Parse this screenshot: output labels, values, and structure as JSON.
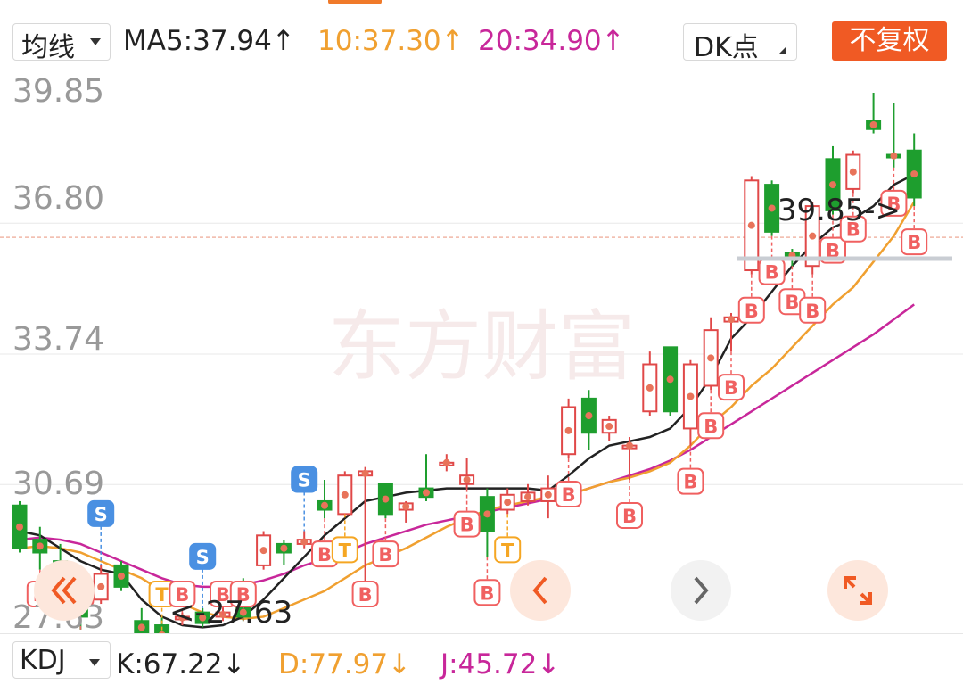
{
  "header": {
    "ma_selector": "均线",
    "ma5": "MA5:37.94↑",
    "ma10": "10:37.30↑",
    "ma20": "20:34.90↑",
    "dk_selector": "DK点",
    "adjust_button": "不复权"
  },
  "colors": {
    "up": "#e04848",
    "down": "#1e9e2e",
    "ma5": "#222222",
    "ma10": "#f0a030",
    "ma20": "#c8279a",
    "accent": "#f05a24",
    "marker_b": "#f06060",
    "marker_s": "#4a90e2",
    "marker_t": "#f5a623"
  },
  "chart": {
    "y_labels": [
      "39.85",
      "36.80",
      "33.74",
      "30.69",
      "27.63"
    ],
    "high_annotation": "39.85->",
    "low_annotation": "<-27.63",
    "watermark": "东方财富",
    "nav_icons": [
      "double-left-icon",
      "left-chevron-icon",
      "right-chevron-icon",
      "expand-icon"
    ]
  },
  "chart_data": {
    "type": "candlestick",
    "y_range": [
      27.63,
      39.85
    ],
    "ma_labels": [
      "MA5",
      "10",
      "20"
    ],
    "candles": [
      {
        "o": 30.2,
        "c": 29.2,
        "h": 30.3,
        "l": 29.1,
        "m": ""
      },
      {
        "o": 29.4,
        "c": 29.1,
        "h": 29.7,
        "l": 28.7,
        "m": "B"
      },
      {
        "o": 28.9,
        "c": 28.2,
        "h": 29.3,
        "l": 28.1,
        "m": ""
      },
      {
        "o": 27.9,
        "c": 27.6,
        "h": 28.4,
        "l": 27.3,
        "m": "B"
      },
      {
        "o": 28.0,
        "c": 28.6,
        "h": 28.8,
        "l": 27.9,
        "m": "S"
      },
      {
        "o": 28.8,
        "c": 28.3,
        "h": 28.9,
        "l": 28.2,
        "m": ""
      },
      {
        "o": 27.5,
        "c": 27.2,
        "h": 27.8,
        "l": 26.95,
        "m": ""
      },
      {
        "o": 27.4,
        "c": 26.95,
        "h": 27.6,
        "l": 26.7,
        "m": "T"
      },
      {
        "o": 27.55,
        "c": 27.6,
        "h": 27.7,
        "l": 27.4,
        "m": "B"
      },
      {
        "o": 27.7,
        "c": 27.45,
        "h": 27.8,
        "l": 27.35,
        "m": "S"
      },
      {
        "o": 27.6,
        "c": 27.7,
        "h": 28.3,
        "l": 27.5,
        "m": "B"
      },
      {
        "o": 27.8,
        "c": 27.6,
        "h": 28.5,
        "l": 27.5,
        "m": "B"
      },
      {
        "o": 28.8,
        "c": 29.5,
        "h": 29.6,
        "l": 28.7,
        "m": ""
      },
      {
        "o": 29.3,
        "c": 29.1,
        "h": 29.4,
        "l": 28.8,
        "m": ""
      },
      {
        "o": 29.3,
        "c": 29.4,
        "h": 29.6,
        "l": 29.2,
        "m": "S"
      },
      {
        "o": 30.3,
        "c": 30.1,
        "h": 30.8,
        "l": 29.9,
        "m": "B"
      },
      {
        "o": 30.0,
        "c": 30.9,
        "h": 31.0,
        "l": 30.0,
        "m": "T"
      },
      {
        "o": 30.9,
        "c": 31.0,
        "h": 31.1,
        "l": 28.0,
        "m": "B"
      },
      {
        "o": 30.7,
        "c": 30.0,
        "h": 30.7,
        "l": 29.9,
        "m": "B"
      },
      {
        "o": 30.1,
        "c": 30.25,
        "h": 30.3,
        "l": 29.8,
        "m": ""
      },
      {
        "o": 30.6,
        "c": 30.4,
        "h": 31.4,
        "l": 30.3,
        "m": ""
      },
      {
        "o": 31.2,
        "c": 31.2,
        "h": 31.4,
        "l": 31.0,
        "m": ""
      },
      {
        "o": 30.7,
        "c": 30.9,
        "h": 31.3,
        "l": 30.6,
        "m": "B"
      },
      {
        "o": 30.4,
        "c": 29.6,
        "h": 30.6,
        "l": 29.0,
        "m": "B"
      },
      {
        "o": 30.1,
        "c": 30.45,
        "h": 30.6,
        "l": 30.0,
        "m": "T"
      },
      {
        "o": 30.3,
        "c": 30.5,
        "h": 30.7,
        "l": 30.2,
        "m": ""
      },
      {
        "o": 30.3,
        "c": 30.6,
        "h": 30.9,
        "l": 29.9,
        "m": ""
      },
      {
        "o": 31.4,
        "c": 32.5,
        "h": 32.7,
        "l": 31.3,
        "m": "B"
      },
      {
        "o": 32.7,
        "c": 31.9,
        "h": 32.9,
        "l": 31.5,
        "m": ""
      },
      {
        "o": 31.9,
        "c": 32.2,
        "h": 32.3,
        "l": 31.7,
        "m": ""
      },
      {
        "o": 31.6,
        "c": 31.6,
        "h": 31.8,
        "l": 30.8,
        "m": "B"
      },
      {
        "o": 32.4,
        "c": 33.5,
        "h": 33.8,
        "l": 32.3,
        "m": ""
      },
      {
        "o": 33.9,
        "c": 32.4,
        "h": 33.9,
        "l": 32.3,
        "m": ""
      },
      {
        "o": 32.0,
        "c": 33.5,
        "h": 33.6,
        "l": 31.6,
        "m": "B"
      },
      {
        "o": 33.0,
        "c": 34.3,
        "h": 34.6,
        "l": 32.9,
        "m": "B"
      },
      {
        "o": 34.5,
        "c": 34.6,
        "h": 34.7,
        "l": 33.8,
        "m": "B"
      },
      {
        "o": 35.7,
        "c": 37.8,
        "h": 37.9,
        "l": 35.6,
        "m": "B"
      },
      {
        "o": 37.7,
        "c": 36.6,
        "h": 37.8,
        "l": 36.5,
        "m": "B"
      },
      {
        "o": 36.1,
        "c": 36.0,
        "h": 36.2,
        "l": 35.8,
        "m": "B"
      },
      {
        "o": 35.8,
        "c": 37.2,
        "h": 37.3,
        "l": 35.6,
        "m": "B"
      },
      {
        "o": 38.3,
        "c": 37.1,
        "h": 38.6,
        "l": 37.0,
        "m": "B"
      },
      {
        "o": 37.6,
        "c": 38.4,
        "h": 38.5,
        "l": 37.5,
        "m": "B"
      },
      {
        "o": 39.2,
        "c": 39.0,
        "h": 39.85,
        "l": 38.9,
        "m": ""
      },
      {
        "o": 38.4,
        "c": 38.35,
        "h": 39.6,
        "l": 38.1,
        "m": "B"
      },
      {
        "o": 38.5,
        "c": 37.4,
        "h": 38.9,
        "l": 37.2,
        "m": "B"
      }
    ],
    "ma5": [
      29.6,
      29.5,
      29.2,
      28.9,
      28.7,
      28.6,
      28.0,
      27.6,
      27.4,
      27.35,
      27.4,
      27.6,
      28.0,
      28.5,
      29.0,
      29.5,
      29.9,
      30.3,
      30.4,
      30.5,
      30.55,
      30.6,
      30.6,
      30.6,
      30.6,
      30.6,
      30.55,
      30.9,
      31.3,
      31.6,
      31.7,
      31.8,
      32.0,
      32.5,
      33.2,
      34.1,
      34.6,
      35.2,
      35.8,
      36.3,
      36.7,
      36.9,
      37.2,
      37.7,
      37.94
    ],
    "ma10": [
      29.2,
      29.25,
      29.2,
      29.1,
      28.9,
      28.7,
      28.5,
      28.2,
      27.9,
      27.7,
      27.6,
      27.55,
      27.6,
      27.8,
      28.0,
      28.2,
      28.5,
      28.8,
      29.0,
      29.2,
      29.45,
      29.7,
      29.9,
      30.1,
      30.2,
      30.3,
      30.4,
      30.45,
      30.6,
      30.75,
      30.85,
      31.0,
      31.2,
      31.6,
      32.1,
      32.5,
      33.0,
      33.4,
      33.9,
      34.4,
      34.9,
      35.3,
      35.9,
      36.5,
      37.3
    ],
    "ma20": [
      29.4,
      29.45,
      29.4,
      29.3,
      29.1,
      28.9,
      28.7,
      28.5,
      28.35,
      28.3,
      28.3,
      28.35,
      28.45,
      28.6,
      28.8,
      28.95,
      29.1,
      29.3,
      29.45,
      29.6,
      29.75,
      29.85,
      29.95,
      30.05,
      30.15,
      30.25,
      30.35,
      30.45,
      30.6,
      30.75,
      30.9,
      31.05,
      31.25,
      31.5,
      31.8,
      32.1,
      32.4,
      32.7,
      33.0,
      33.3,
      33.6,
      33.9,
      34.2,
      34.55,
      34.9
    ]
  },
  "footer": {
    "indicator_selector": "KDJ",
    "k": "K:67.22↓",
    "d": "D:77.97↓",
    "j": "J:45.72↓"
  }
}
